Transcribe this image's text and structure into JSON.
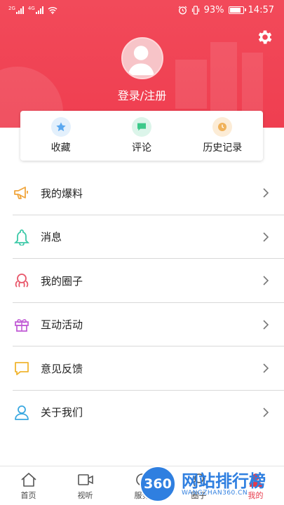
{
  "status_bar": {
    "signal1_tag": "2G",
    "signal2_tag": "4G",
    "battery_percent": "93%",
    "time": "14:57",
    "battery_level": 0.93
  },
  "header": {
    "login_label": "登录/注册",
    "background_color": "#ef3e50"
  },
  "quick_actions": [
    {
      "label": "收藏",
      "icon": "star-icon",
      "color": "#5aa8f0"
    },
    {
      "label": "评论",
      "icon": "comment-icon",
      "color": "#3cc98a"
    },
    {
      "label": "历史记录",
      "icon": "clock-icon",
      "color": "#f0b25a"
    }
  ],
  "menu": [
    {
      "label": "我的爆料",
      "icon": "megaphone-icon",
      "color": "#f0a53c"
    },
    {
      "label": "消息",
      "icon": "bell-icon",
      "color": "#3cc9a8"
    },
    {
      "label": "我的圈子",
      "icon": "octopus-icon",
      "color": "#e8576a"
    },
    {
      "label": "互动活动",
      "icon": "gift-icon",
      "color": "#c25ed6"
    },
    {
      "label": "意见反馈",
      "icon": "feedback-icon",
      "color": "#f0b530"
    },
    {
      "label": "关于我们",
      "icon": "user-icon",
      "color": "#3aa8e0"
    }
  ],
  "tabbar": [
    {
      "label": "首页",
      "icon": "home-icon"
    },
    {
      "label": "视听",
      "icon": "video-icon"
    },
    {
      "label": "服务",
      "icon": "service-icon"
    },
    {
      "label": "圈子",
      "icon": "circle-icon"
    },
    {
      "label": "我的",
      "icon": "profile-icon",
      "active": true
    }
  ],
  "watermark": {
    "badge": "360",
    "title": "网站排行榜",
    "url": "WANGZHAN360.CN"
  }
}
